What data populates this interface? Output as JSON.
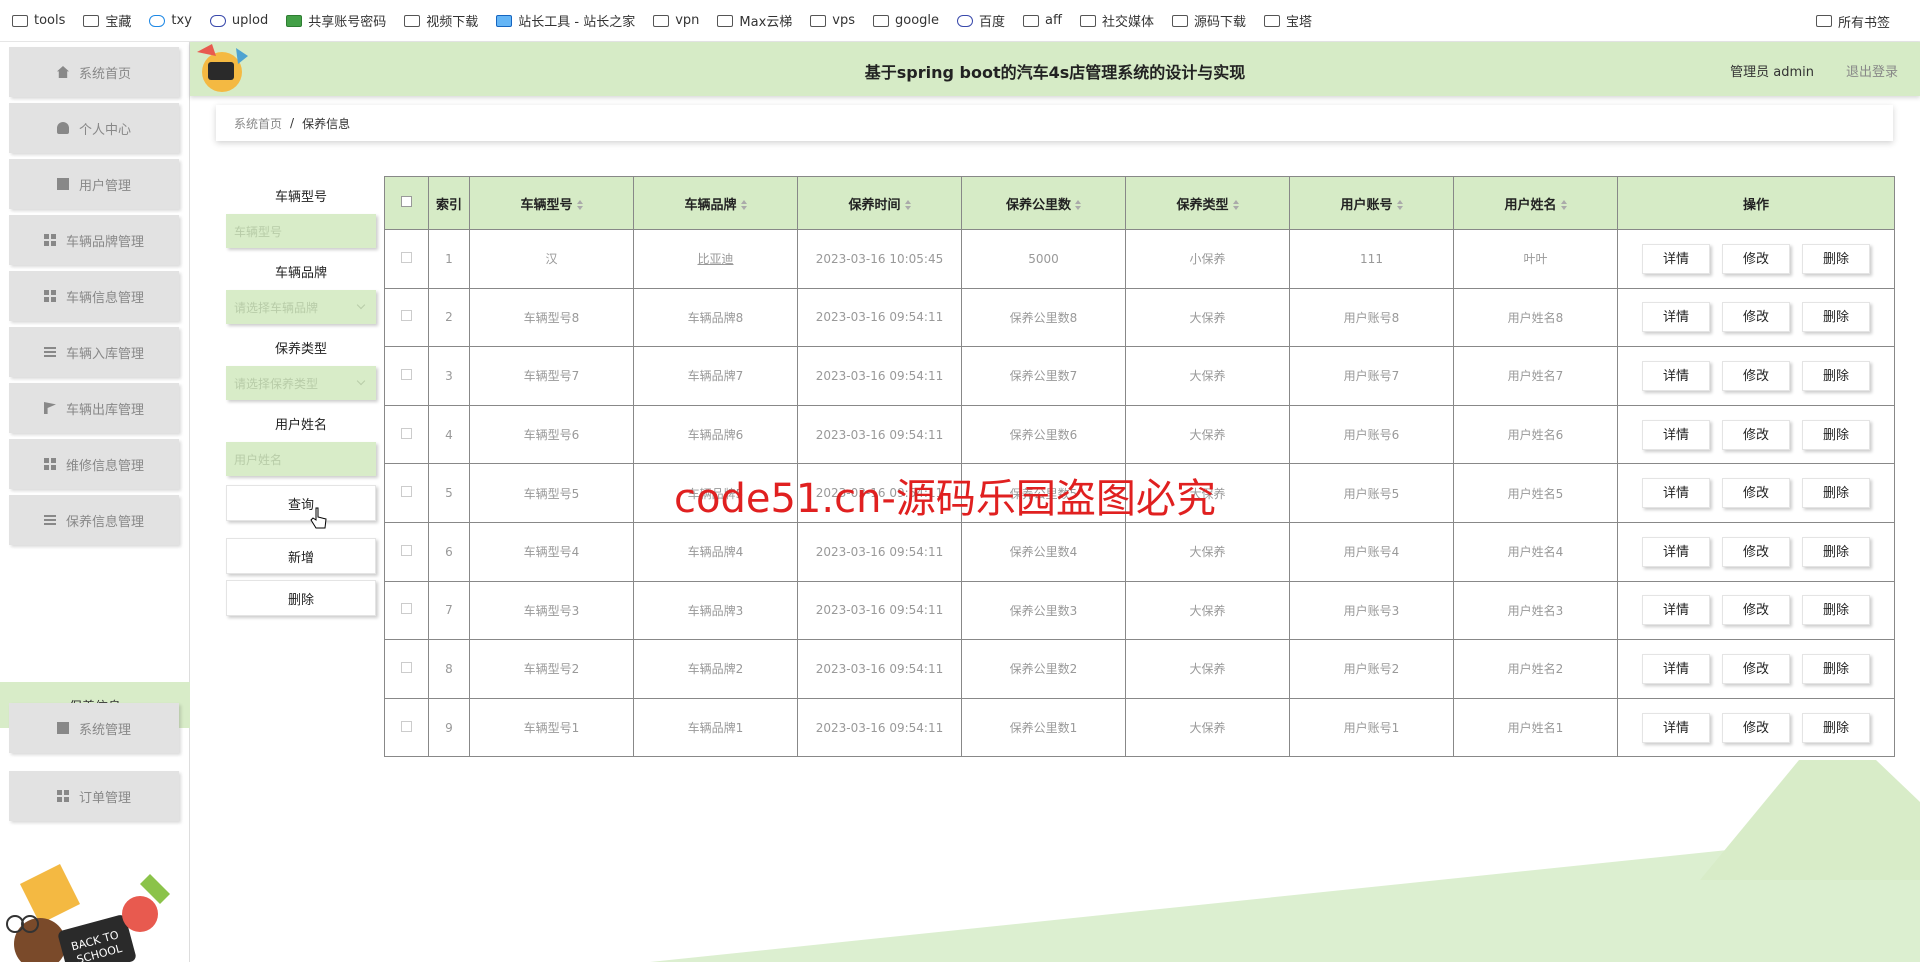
{
  "bookmarks": {
    "items": [
      {
        "label": "tools",
        "icon": "folder-icon"
      },
      {
        "label": "宝藏",
        "icon": "folder-icon"
      },
      {
        "label": "txy",
        "icon": "cloud-icon"
      },
      {
        "label": "uplod",
        "icon": "link-icon"
      },
      {
        "label": "共享账号密码",
        "icon": "doc-icon"
      },
      {
        "label": "视频下载",
        "icon": "folder-icon"
      },
      {
        "label": "站长工具 - 站长之家",
        "icon": "site-icon"
      },
      {
        "label": "vpn",
        "icon": "folder-icon"
      },
      {
        "label": "Max云梯",
        "icon": "folder-icon"
      },
      {
        "label": "vps",
        "icon": "folder-icon"
      },
      {
        "label": "google",
        "icon": "folder-icon"
      },
      {
        "label": "百度",
        "icon": "baidu-icon"
      },
      {
        "label": "aff",
        "icon": "folder-icon"
      },
      {
        "label": "社交媒体",
        "icon": "folder-icon"
      },
      {
        "label": "源码下载",
        "icon": "folder-icon"
      },
      {
        "label": "宝塔",
        "icon": "folder-icon"
      }
    ],
    "all_label": "所有书签"
  },
  "sidebar": {
    "items": [
      {
        "label": "系统首页",
        "icon": "home-icon"
      },
      {
        "label": "个人中心",
        "icon": "user-icon"
      },
      {
        "label": "用户管理",
        "icon": "clipboard-icon"
      },
      {
        "label": "车辆品牌管理",
        "icon": "grid-icon"
      },
      {
        "label": "车辆信息管理",
        "icon": "grid-icon"
      },
      {
        "label": "车辆入库管理",
        "icon": "list-icon"
      },
      {
        "label": "车辆出库管理",
        "icon": "flag-icon"
      },
      {
        "label": "维修信息管理",
        "icon": "grid-icon"
      },
      {
        "label": "保养信息管理",
        "icon": "list-icon"
      }
    ],
    "active_sub": "保养信息",
    "bottom_items": [
      {
        "label": "系统管理",
        "icon": "chart-icon"
      },
      {
        "label": "订单管理",
        "icon": "grid-icon"
      }
    ]
  },
  "header": {
    "title": "基于spring boot的汽车4s店管理系统的设计与实现",
    "admin": "管理员 admin",
    "logout": "退出登录"
  },
  "breadcrumb": {
    "home": "系统首页",
    "sep": "/",
    "current": "保养信息"
  },
  "search": {
    "model_label": "车辆型号",
    "model_placeholder": "车辆型号",
    "brand_label": "车辆品牌",
    "brand_placeholder": "请选择车辆品牌",
    "type_label": "保养类型",
    "type_placeholder": "请选择保养类型",
    "name_label": "用户姓名",
    "name_placeholder": "用户姓名",
    "query_button": "查询",
    "add_button": "新增",
    "delete_button": "删除"
  },
  "table": {
    "headers": {
      "index": "索引",
      "model": "车辆型号",
      "brand": "车辆品牌",
      "time": "保养时间",
      "km": "保养公里数",
      "type": "保养类型",
      "account": "用户账号",
      "name": "用户姓名",
      "ops": "操作"
    },
    "actions": {
      "detail": "详情",
      "edit": "修改",
      "delete": "删除"
    },
    "rows": [
      {
        "index": "1",
        "model": "汉",
        "brand": "比亚迪",
        "time": "2023-03-16 10:05:45",
        "km": "5000",
        "type": "小保养",
        "account": "111",
        "name": "叶叶"
      },
      {
        "index": "2",
        "model": "车辆型号8",
        "brand": "车辆品牌8",
        "time": "2023-03-16 09:54:11",
        "km": "保养公里数8",
        "type": "大保养",
        "account": "用户账号8",
        "name": "用户姓名8"
      },
      {
        "index": "3",
        "model": "车辆型号7",
        "brand": "车辆品牌7",
        "time": "2023-03-16 09:54:11",
        "km": "保养公里数7",
        "type": "大保养",
        "account": "用户账号7",
        "name": "用户姓名7"
      },
      {
        "index": "4",
        "model": "车辆型号6",
        "brand": "车辆品牌6",
        "time": "2023-03-16 09:54:11",
        "km": "保养公里数6",
        "type": "大保养",
        "account": "用户账号6",
        "name": "用户姓名6"
      },
      {
        "index": "5",
        "model": "车辆型号5",
        "brand": "车辆品牌5",
        "time": "2023-03-16 09:54:11",
        "km": "保养公里数5",
        "type": "大保养",
        "account": "用户账号5",
        "name": "用户姓名5"
      },
      {
        "index": "6",
        "model": "车辆型号4",
        "brand": "车辆品牌4",
        "time": "2023-03-16 09:54:11",
        "km": "保养公里数4",
        "type": "大保养",
        "account": "用户账号4",
        "name": "用户姓名4"
      },
      {
        "index": "7",
        "model": "车辆型号3",
        "brand": "车辆品牌3",
        "time": "2023-03-16 09:54:11",
        "km": "保养公里数3",
        "type": "大保养",
        "account": "用户账号3",
        "name": "用户姓名3"
      },
      {
        "index": "8",
        "model": "车辆型号2",
        "brand": "车辆品牌2",
        "time": "2023-03-16 09:54:11",
        "km": "保养公里数2",
        "type": "大保养",
        "account": "用户账号2",
        "name": "用户姓名2"
      },
      {
        "index": "9",
        "model": "车辆型号1",
        "brand": "车辆品牌1",
        "time": "2023-03-16 09:54:11",
        "km": "保养公里数1",
        "type": "大保养",
        "account": "用户账号1",
        "name": "用户姓名1"
      }
    ]
  },
  "watermark": "code51.cn-源码乐园盗图必究",
  "colors": {
    "accent": "#d6ebc6",
    "sidebar_item": "#e2e2e2",
    "watermark": "#e02020"
  }
}
